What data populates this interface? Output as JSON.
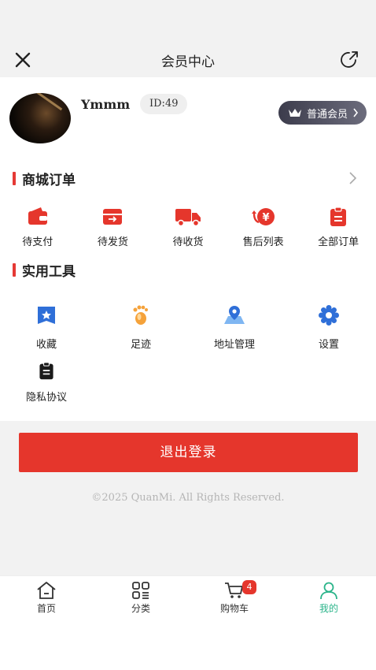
{
  "header": {
    "title": "会员中心"
  },
  "profile": {
    "username": "Ymmm",
    "id": "ID:49",
    "member_level": "普通会员"
  },
  "orders_section": {
    "title": "商城订单",
    "items": [
      {
        "label": "待支付",
        "icon": "wallet-icon"
      },
      {
        "label": "待发货",
        "icon": "box-icon"
      },
      {
        "label": "待收货",
        "icon": "truck-icon"
      },
      {
        "label": "售后列表",
        "icon": "refund-icon"
      },
      {
        "label": "全部订单",
        "icon": "clipboard-icon"
      }
    ]
  },
  "tools_section": {
    "title": "实用工具",
    "items": [
      {
        "label": "收藏",
        "icon": "bookmark-star-icon"
      },
      {
        "label": "足迹",
        "icon": "footprint-icon"
      },
      {
        "label": "地址管理",
        "icon": "map-pin-icon"
      },
      {
        "label": "设置",
        "icon": "gear-icon"
      },
      {
        "label": "隐私协议",
        "icon": "document-icon"
      }
    ]
  },
  "logout_label": "退出登录",
  "copyright": "©2025 QuanMi. All Rights Reserved.",
  "tabbar": {
    "items": [
      {
        "label": "首页",
        "icon": "home-icon",
        "active": false
      },
      {
        "label": "分类",
        "icon": "category-icon",
        "active": false
      },
      {
        "label": "购物车",
        "icon": "cart-icon",
        "active": false,
        "badge": "4"
      },
      {
        "label": "我的",
        "icon": "user-icon",
        "active": true
      }
    ]
  },
  "colors": {
    "accent_red": "#e5362c",
    "active_tab": "#2bb48a",
    "tool_blue": "#2f6fd8",
    "tool_orange": "#f5a23a"
  }
}
